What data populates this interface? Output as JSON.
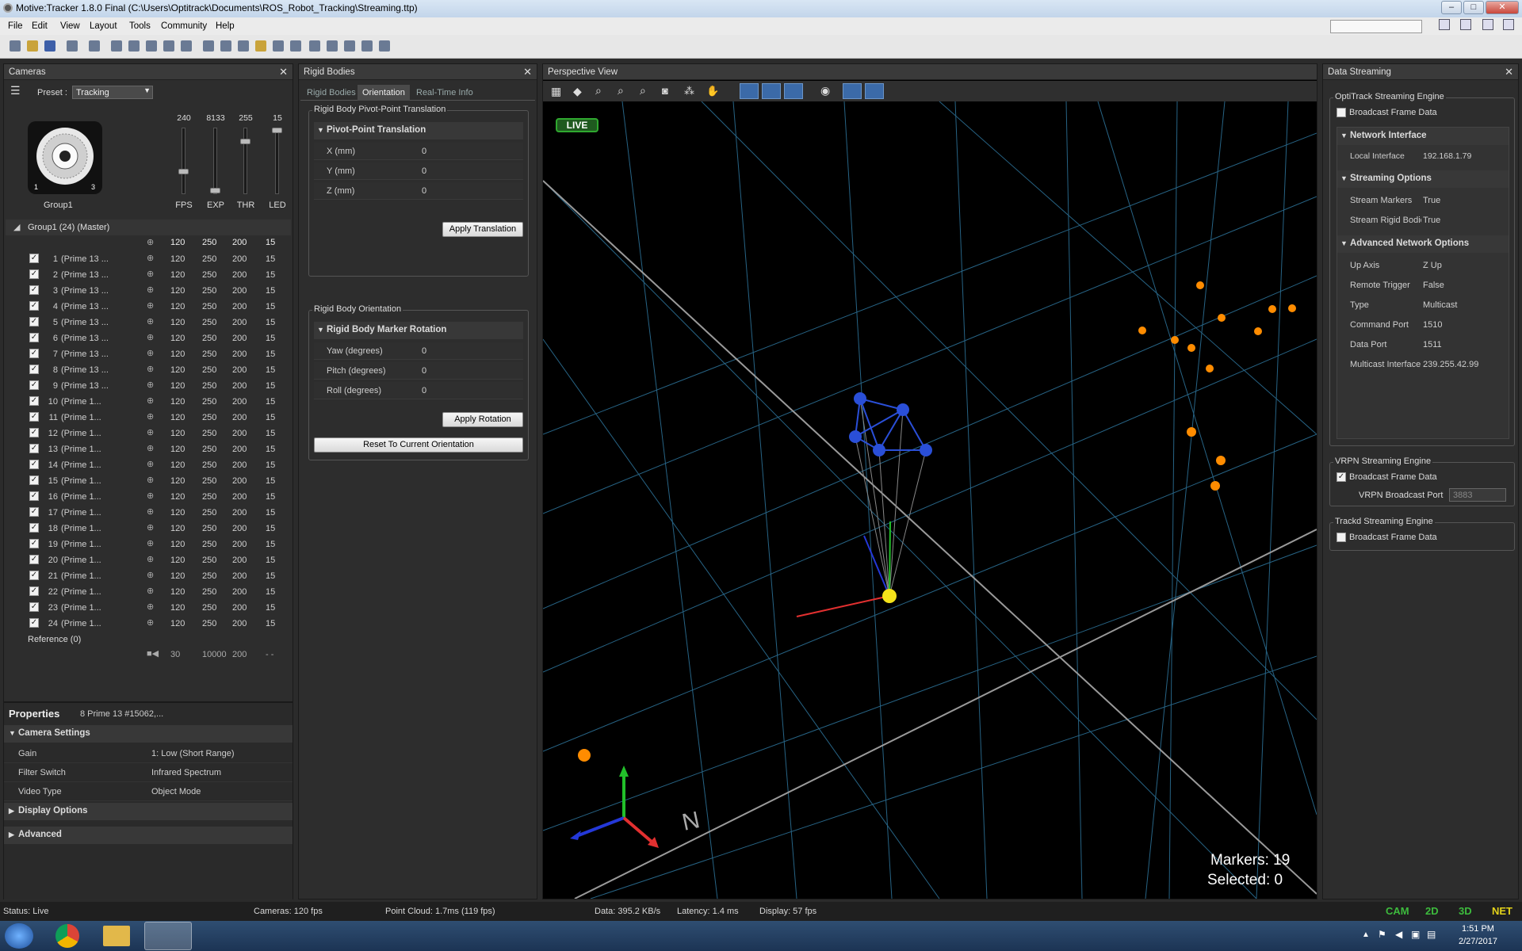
{
  "title": "Motive:Tracker 1.8.0 Final (C:\\Users\\Optitrack\\Documents\\ROS_Robot_Tracking\\Streaming.ttp)",
  "window_controls": {
    "minimize": "–",
    "maximize": "□",
    "close": "✕"
  },
  "menu": [
    "File",
    "Edit",
    "View",
    "Layout",
    "Tools",
    "Community",
    "Help"
  ],
  "cameras_panel": {
    "title": "Cameras",
    "preset_label": "Preset :",
    "preset_value": "Tracking",
    "group_name": "Group1",
    "sliders": [
      {
        "label": "FPS",
        "value": "240",
        "level": 0.35
      },
      {
        "label": "EXP",
        "value": "8133",
        "level": 0.05
      },
      {
        "label": "THR",
        "value": "255",
        "level": 0.82
      },
      {
        "label": "LED",
        "value": "15",
        "level": 1.0
      }
    ],
    "group_header": "Group1 (24) (Master)",
    "group_values": [
      "120",
      "250",
      "200",
      "15"
    ],
    "cameras": [
      {
        "n": "1",
        "name": "(Prime 13 ..."
      },
      {
        "n": "2",
        "name": "(Prime 13 ..."
      },
      {
        "n": "3",
        "name": "(Prime 13 ..."
      },
      {
        "n": "4",
        "name": "(Prime 13 ..."
      },
      {
        "n": "5",
        "name": "(Prime 13 ..."
      },
      {
        "n": "6",
        "name": "(Prime 13 ..."
      },
      {
        "n": "7",
        "name": "(Prime 13 ..."
      },
      {
        "n": "8",
        "name": "(Prime 13 ..."
      },
      {
        "n": "9",
        "name": "(Prime 13 ..."
      },
      {
        "n": "10",
        "name": "(Prime 1..."
      },
      {
        "n": "11",
        "name": "(Prime 1..."
      },
      {
        "n": "12",
        "name": "(Prime 1..."
      },
      {
        "n": "13",
        "name": "(Prime 1..."
      },
      {
        "n": "14",
        "name": "(Prime 1..."
      },
      {
        "n": "15",
        "name": "(Prime 1..."
      },
      {
        "n": "16",
        "name": "(Prime 1..."
      },
      {
        "n": "17",
        "name": "(Prime 1..."
      },
      {
        "n": "18",
        "name": "(Prime 1..."
      },
      {
        "n": "19",
        "name": "(Prime 1..."
      },
      {
        "n": "20",
        "name": "(Prime 1..."
      },
      {
        "n": "21",
        "name": "(Prime 1..."
      },
      {
        "n": "22",
        "name": "(Prime 1..."
      },
      {
        "n": "23",
        "name": "(Prime 1..."
      },
      {
        "n": "24",
        "name": "(Prime 1..."
      }
    ],
    "camera_values": [
      "120",
      "250",
      "200",
      "15"
    ],
    "reference_label": "Reference (0)",
    "reference_values": [
      "30",
      "10000",
      "200",
      "- -"
    ]
  },
  "properties": {
    "title": "Properties",
    "subtitle": "8 Prime 13 #15062,...",
    "camera_settings": "Camera Settings",
    "items": [
      {
        "key": "Gain",
        "value": "1: Low (Short Range)"
      },
      {
        "key": "Filter Switch",
        "value": "Infrared Spectrum"
      },
      {
        "key": "Video Type",
        "value": "Object Mode"
      }
    ],
    "display_options": "Display Options",
    "advanced": "Advanced"
  },
  "rigid_bodies": {
    "title": "Rigid Bodies",
    "tabs": [
      "Rigid Bodies",
      "Orientation",
      "Real-Time Info"
    ],
    "pivot_group": "Rigid Body Pivot-Point Translation",
    "pivot_section": "Pivot-Point Translation",
    "pivot_fields": [
      {
        "key": "X (mm)",
        "value": "0"
      },
      {
        "key": "Y (mm)",
        "value": "0"
      },
      {
        "key": "Z (mm)",
        "value": "0"
      }
    ],
    "apply_translation": "Apply Translation",
    "orientation_group": "Rigid Body Orientation",
    "rotation_section": "Rigid Body Marker Rotation",
    "rotation_fields": [
      {
        "key": "Yaw (degrees)",
        "value": "0"
      },
      {
        "key": "Pitch (degrees)",
        "value": "0"
      },
      {
        "key": "Roll (degrees)",
        "value": "0"
      }
    ],
    "apply_rotation": "Apply Rotation",
    "reset_orientation": "Reset To Current Orientation"
  },
  "perspective": {
    "title": "Perspective View",
    "live": "LIVE",
    "markers": "Markers: 19",
    "selected": "Selected: 0",
    "north": "N"
  },
  "data_streaming": {
    "title": "Data Streaming",
    "optitrack_group": "OptiTrack Streaming Engine",
    "broadcast_label": "Broadcast Frame Data",
    "network_interface": "Network Interface",
    "local_interface": {
      "key": "Local Interface",
      "value": "192.168.1.79"
    },
    "streaming_options": "Streaming Options",
    "stream_items": [
      {
        "key": "Stream Markers",
        "value": "True"
      },
      {
        "key": "Stream Rigid Bodie",
        "value": "True"
      }
    ],
    "advanced_network": "Advanced Network Options",
    "advanced_items": [
      {
        "key": "Up Axis",
        "value": "Z Up"
      },
      {
        "key": "Remote Trigger",
        "value": "False"
      },
      {
        "key": "Type",
        "value": "Multicast"
      },
      {
        "key": "Command Port",
        "value": "1510"
      },
      {
        "key": "Data Port",
        "value": "1511"
      },
      {
        "key": "Multicast Interface",
        "value": "239.255.42.99"
      }
    ],
    "vrpn_group": "VRPN Streaming Engine",
    "vrpn_broadcast": "Broadcast Frame Data",
    "vrpn_port_label": "VRPN Broadcast Port",
    "vrpn_port_value": "3883",
    "trackd_group": "Trackd Streaming Engine",
    "trackd_broadcast": "Broadcast Frame Data"
  },
  "status": {
    "status": "Status: Live",
    "cameras": "Cameras: 120 fps",
    "point_cloud": "Point Cloud: 1.7ms (119 fps)",
    "data": "Data: 395.2 KB/s",
    "latency": "Latency: 1.4 ms",
    "display": "Display: 57 fps",
    "indicators": [
      "CAM",
      "2D",
      "3D",
      "NET"
    ]
  },
  "taskbar": {
    "time": "1:51 PM",
    "date": "2/27/2017"
  },
  "colors": {
    "marker_orange": "#ff8c00",
    "marker_blue": "#2a4fd8",
    "grid_blue": "#2c6f94",
    "live_green": "#2fa82f",
    "indicator_green": "#3dbb3d"
  }
}
